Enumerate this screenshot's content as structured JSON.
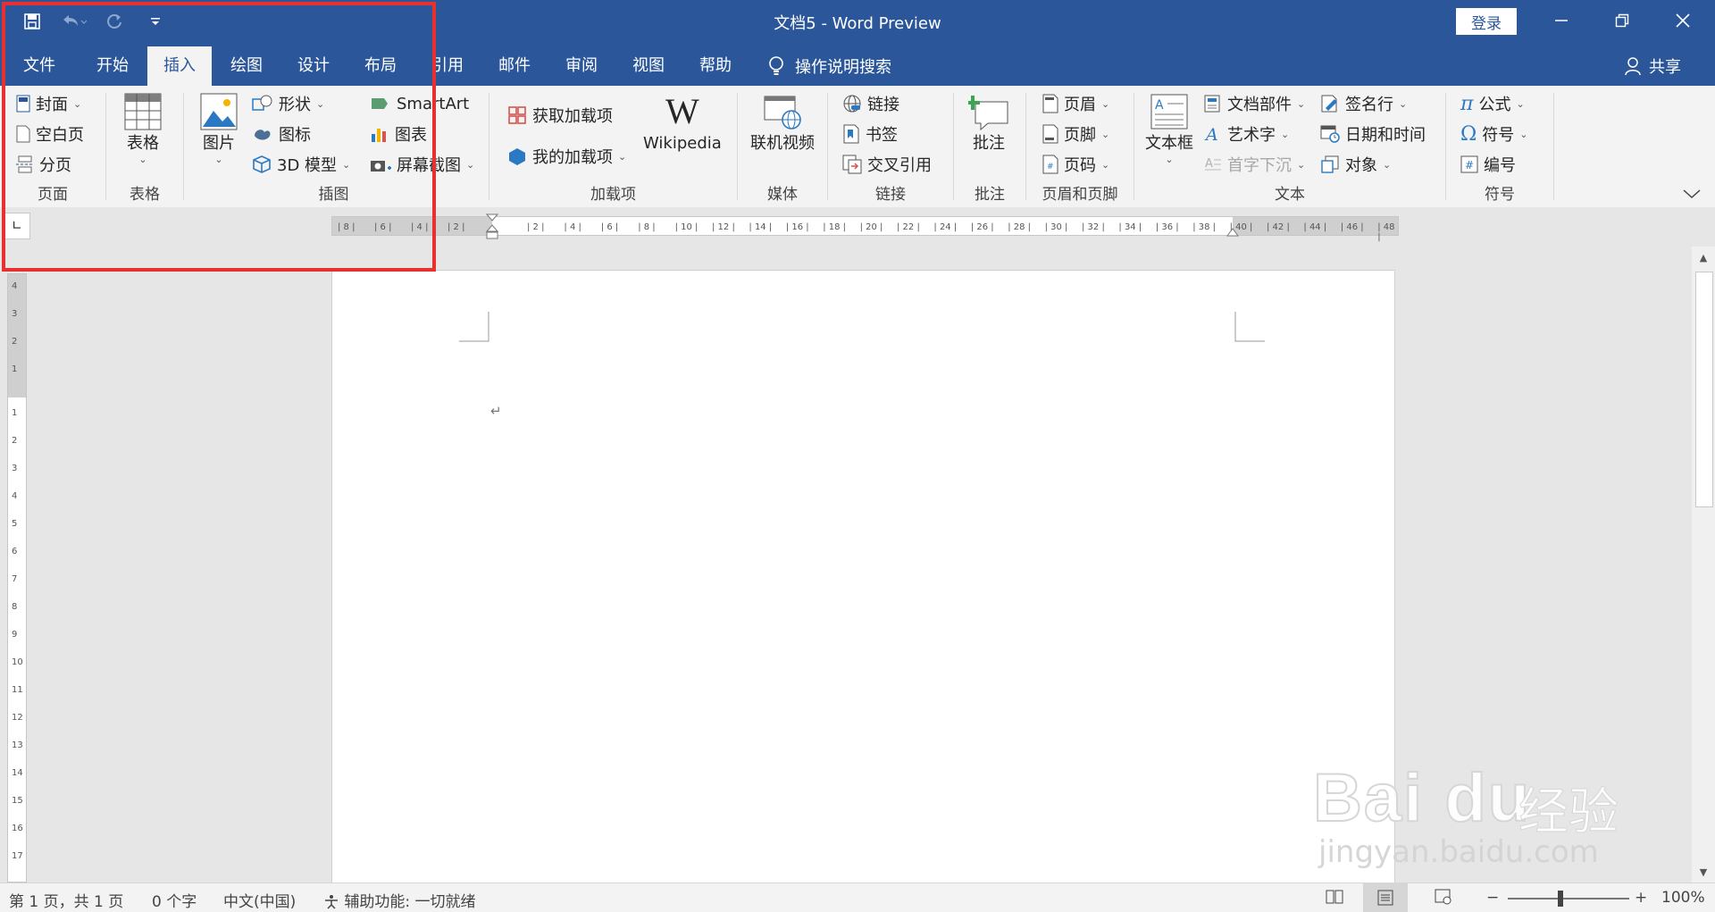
{
  "window": {
    "title": "文档5  -  Word Preview",
    "login": "登录"
  },
  "tabs": [
    "文件",
    "开始",
    "插入",
    "绘图",
    "设计",
    "布局",
    "引用",
    "邮件",
    "审阅",
    "视图",
    "帮助"
  ],
  "active_tab": "插入",
  "tell_me": "操作说明搜索",
  "share": "共享",
  "ribbon": {
    "pages": {
      "label": "页面",
      "cover": "封面",
      "blank": "空白页",
      "break": "分页"
    },
    "tables": {
      "label": "表格",
      "table": "表格"
    },
    "illustrations": {
      "label": "插图",
      "pictures": "图片",
      "shapes": "形状",
      "icons": "图标",
      "model3d": "3D 模型",
      "smartart": "SmartArt",
      "chart": "图表",
      "screenshot": "屏幕截图"
    },
    "addins": {
      "label": "加载项",
      "get": "获取加载项",
      "my": "我的加载项",
      "wikipedia": "Wikipedia"
    },
    "media": {
      "label": "媒体",
      "video": "联机视频"
    },
    "links": {
      "label": "链接",
      "link": "链接",
      "bookmark": "书签",
      "crossref": "交叉引用"
    },
    "comments": {
      "label": "批注",
      "comment": "批注"
    },
    "headerfooter": {
      "label": "页眉和页脚",
      "header": "页眉",
      "footer": "页脚",
      "pagenum": "页码"
    },
    "text": {
      "label": "文本",
      "textbox": "文本框",
      "quickparts": "文档部件",
      "wordart": "艺术字",
      "dropcap": "首字下沉",
      "signature": "签名行",
      "datetime": "日期和时间",
      "object": "对象"
    },
    "symbols": {
      "label": "符号",
      "equation": "公式",
      "symbol": "符号",
      "number": "编号"
    }
  },
  "ruler_ticks": [
    "8",
    "6",
    "4",
    "2",
    "2",
    "4",
    "6",
    "8",
    "10",
    "12",
    "14",
    "16",
    "18",
    "20",
    "22",
    "24",
    "26",
    "28",
    "30",
    "32",
    "34",
    "36",
    "38",
    "40",
    "42",
    "44",
    "46",
    "48"
  ],
  "vruler_ticks": [
    "4",
    "3",
    "2",
    "1",
    "1",
    "2",
    "3",
    "4",
    "5",
    "6",
    "7",
    "8",
    "9",
    "10",
    "11",
    "12",
    "13",
    "14",
    "15",
    "16",
    "17"
  ],
  "status": {
    "page": "第 1 页，共 1 页",
    "words": "0 个字",
    "language": "中文(中国)",
    "accessibility": "辅助功能: 一切就绪",
    "zoom": "100%",
    "zoom_minus": "−",
    "zoom_plus": "+",
    "zoom_level": 1.0
  },
  "watermark": {
    "logo": "Bai du",
    "cn": "经验",
    "url": "jingyan.baidu.com"
  },
  "colors": {
    "brand": "#2b579a",
    "highlight": "#e8302f"
  }
}
